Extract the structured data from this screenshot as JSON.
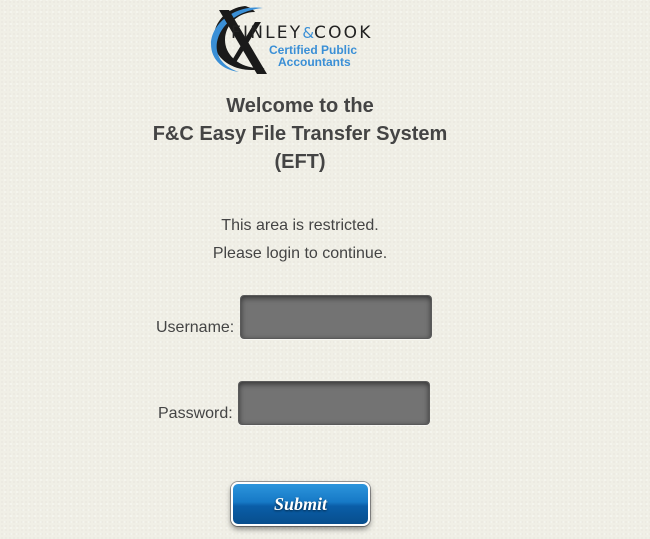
{
  "logo": {
    "brand_left": "FINLEY",
    "brand_amp": "&",
    "brand_right": "COOK",
    "subtitle_line1": "Certified Public",
    "subtitle_line2": "Accountants",
    "colors": {
      "accent": "#3a8fd6",
      "dark": "#222222"
    }
  },
  "heading": {
    "line1": "Welcome to the",
    "line2": "F&C Easy File Transfer System",
    "line3": "(EFT)"
  },
  "notice": {
    "line1": "This area is restricted.",
    "line2": "Please login to continue."
  },
  "form": {
    "username_label": "Username:",
    "username_value": "",
    "password_label": "Password:",
    "password_value": "",
    "submit_label": "Submit"
  },
  "colors": {
    "background": "#f0efe6",
    "text": "#444444",
    "input_fill": "#737373",
    "button_blue": "#1679c6"
  }
}
